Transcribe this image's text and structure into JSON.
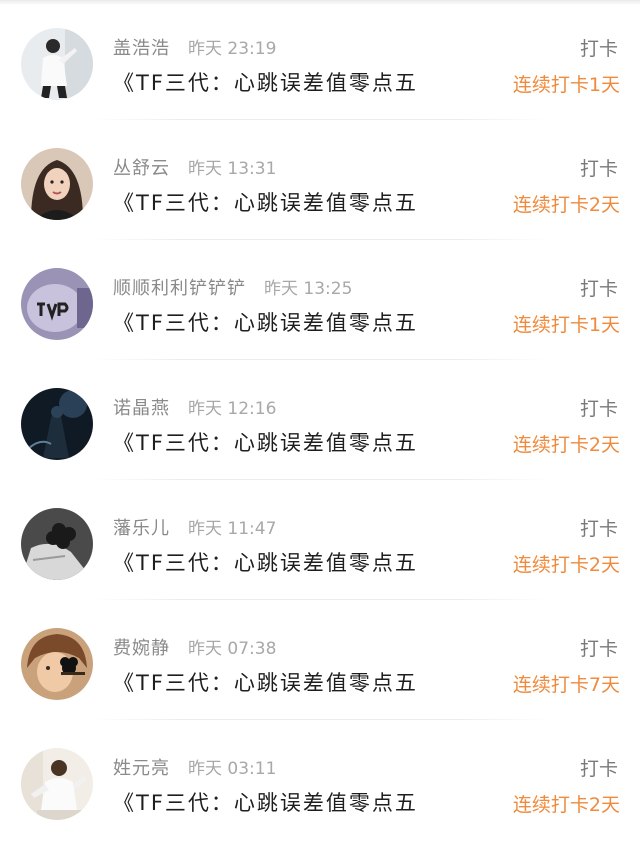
{
  "feed": {
    "items": [
      {
        "name": "盖浩浩",
        "time": "昨天 23:19",
        "title": "《TF三代：心跳误差值零点五",
        "action": "打卡",
        "streak": "连续打卡1天",
        "avatar_icon": "avatar-man-white-shirt-icon"
      },
      {
        "name": "丛舒云",
        "time": "昨天 13:31",
        "title": "《TF三代：心跳误差值零点五",
        "action": "打卡",
        "streak": "连续打卡2天",
        "avatar_icon": "avatar-woman-portrait-icon"
      },
      {
        "name": "顺顺利利铲铲铲",
        "time": "昨天 13:25",
        "title": "《TF三代：心跳误差值零点五",
        "action": "打卡",
        "streak": "连续打卡1天",
        "avatar_icon": "avatar-tvp-hand-icon"
      },
      {
        "name": "诺晶燕",
        "time": "昨天 12:16",
        "title": "《TF三代：心跳误差值零点五",
        "action": "打卡",
        "streak": "连续打卡2天",
        "avatar_icon": "avatar-dark-figure-icon"
      },
      {
        "name": "藩乐儿",
        "time": "昨天 11:47",
        "title": "《TF三代：心跳误差值零点五",
        "action": "打卡",
        "streak": "连续打卡2天",
        "avatar_icon": "avatar-flower-hand-icon"
      },
      {
        "name": "费婉静",
        "time": "昨天 07:38",
        "title": "《TF三代：心跳误差值零点五",
        "action": "打卡",
        "streak": "连续打卡7天",
        "avatar_icon": "avatar-child-flower-icon"
      },
      {
        "name": "姓元亮",
        "time": "昨天 03:11",
        "title": "《TF三代：心跳误差值零点五",
        "action": "打卡",
        "streak": "连续打卡2天",
        "avatar_icon": "avatar-man-bright-room-icon"
      }
    ]
  },
  "colors": {
    "accent": "#f08a3c",
    "title_text": "#1e1e1e",
    "meta_text": "#8c8c8c"
  }
}
